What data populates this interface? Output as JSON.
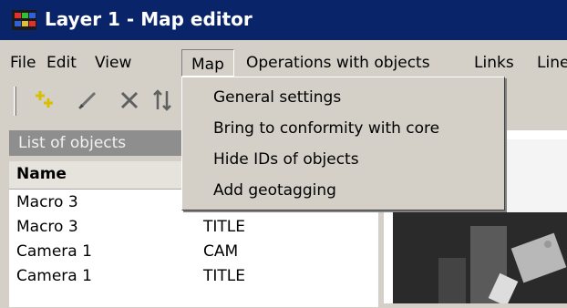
{
  "window": {
    "title": "Layer 1 - Map editor"
  },
  "menubar": {
    "items": [
      "File",
      "Edit",
      "View",
      "Map",
      "Operations with objects",
      "Links",
      "Line"
    ]
  },
  "toolbar": {
    "icons": [
      "add-objects-icon",
      "pencil-icon",
      "delete-icon",
      "move-icon"
    ]
  },
  "map_menu": {
    "items": [
      "General settings",
      "Bring to conformity with core",
      "Hide IDs of objects",
      "Add geotagging"
    ]
  },
  "objects_panel": {
    "title": "List of objects",
    "columns": [
      "Name"
    ],
    "rows": [
      {
        "name": "Macro 3",
        "type": ""
      },
      {
        "name": "Macro 3",
        "type": "TITLE"
      },
      {
        "name": "Camera 1",
        "type": "CAM"
      },
      {
        "name": "Camera 1",
        "type": "TITLE"
      }
    ]
  },
  "colors": {
    "titlebar": "#0a246a",
    "chrome": "#d4d0c8",
    "panel_header": "#8e8e8e"
  }
}
